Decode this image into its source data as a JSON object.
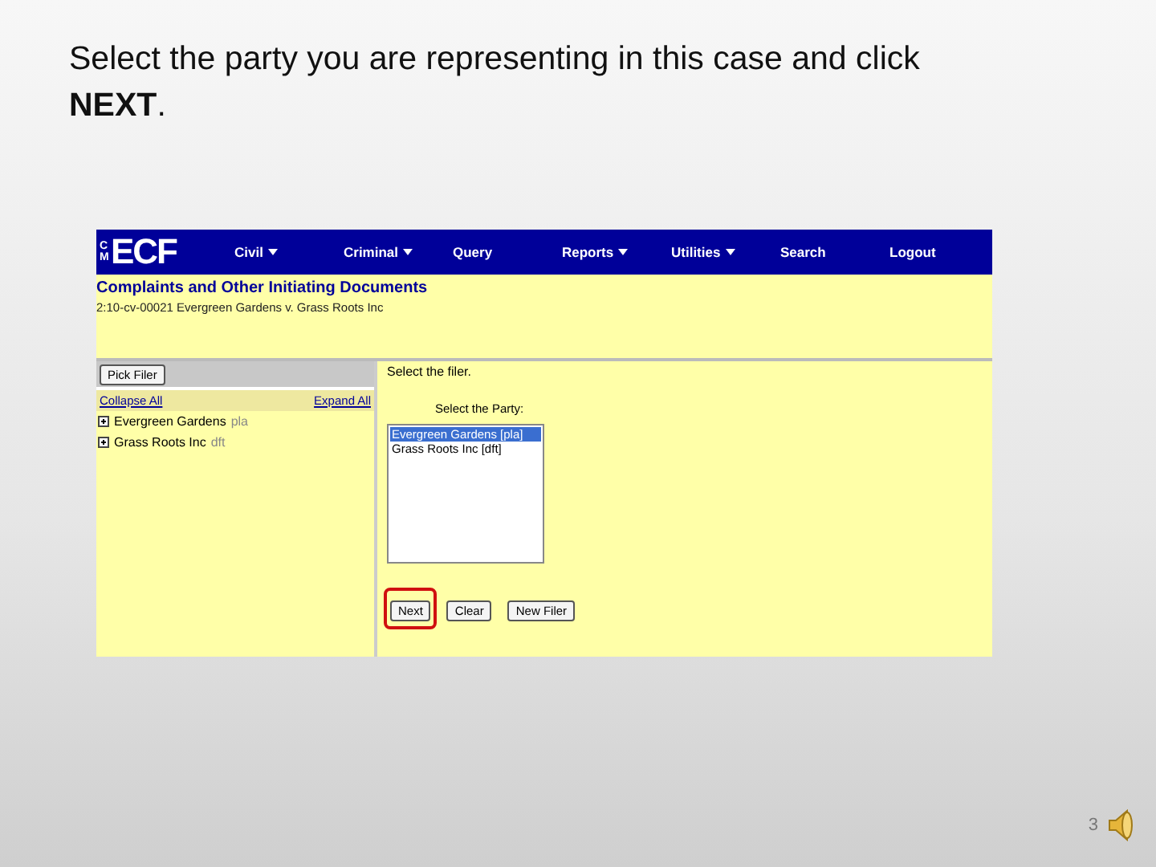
{
  "slide": {
    "instruction": "Select the party you are representing in this case and click **NEXT**.",
    "page_number": "3"
  },
  "app": {
    "logo": {
      "prefix": "CM",
      "name": "ECF"
    },
    "menu": [
      {
        "label": "Civil",
        "dropdown": true
      },
      {
        "label": "Criminal",
        "dropdown": true
      },
      {
        "label": "Query",
        "dropdown": false
      },
      {
        "label": "Reports",
        "dropdown": true
      },
      {
        "label": "Utilities",
        "dropdown": true
      },
      {
        "label": "Search",
        "dropdown": false
      },
      {
        "label": "Logout",
        "dropdown": false
      }
    ],
    "page_title": "Complaints and Other Initiating Documents",
    "case": "2:10-cv-00021 Evergreen Gardens v. Grass Roots Inc",
    "pick_filer_button": "Pick Filer",
    "collapse_all": "Collapse All",
    "expand_all": "Expand All",
    "tree": [
      {
        "name": "Evergreen Gardens",
        "role": "pla",
        "expanded": false
      },
      {
        "name": "Grass Roots Inc",
        "role": "dft",
        "expanded": false
      }
    ],
    "prompt": "Select the filer.",
    "party_label": "Select the Party:",
    "parties": [
      {
        "label": "Evergreen Gardens [pla]",
        "selected": true
      },
      {
        "label": "Grass Roots Inc [dft]",
        "selected": false
      }
    ],
    "buttons": [
      {
        "label": "Next",
        "highlighted": true
      },
      {
        "label": "Clear",
        "highlighted": false
      },
      {
        "label": "New Filer",
        "highlighted": false
      }
    ]
  }
}
